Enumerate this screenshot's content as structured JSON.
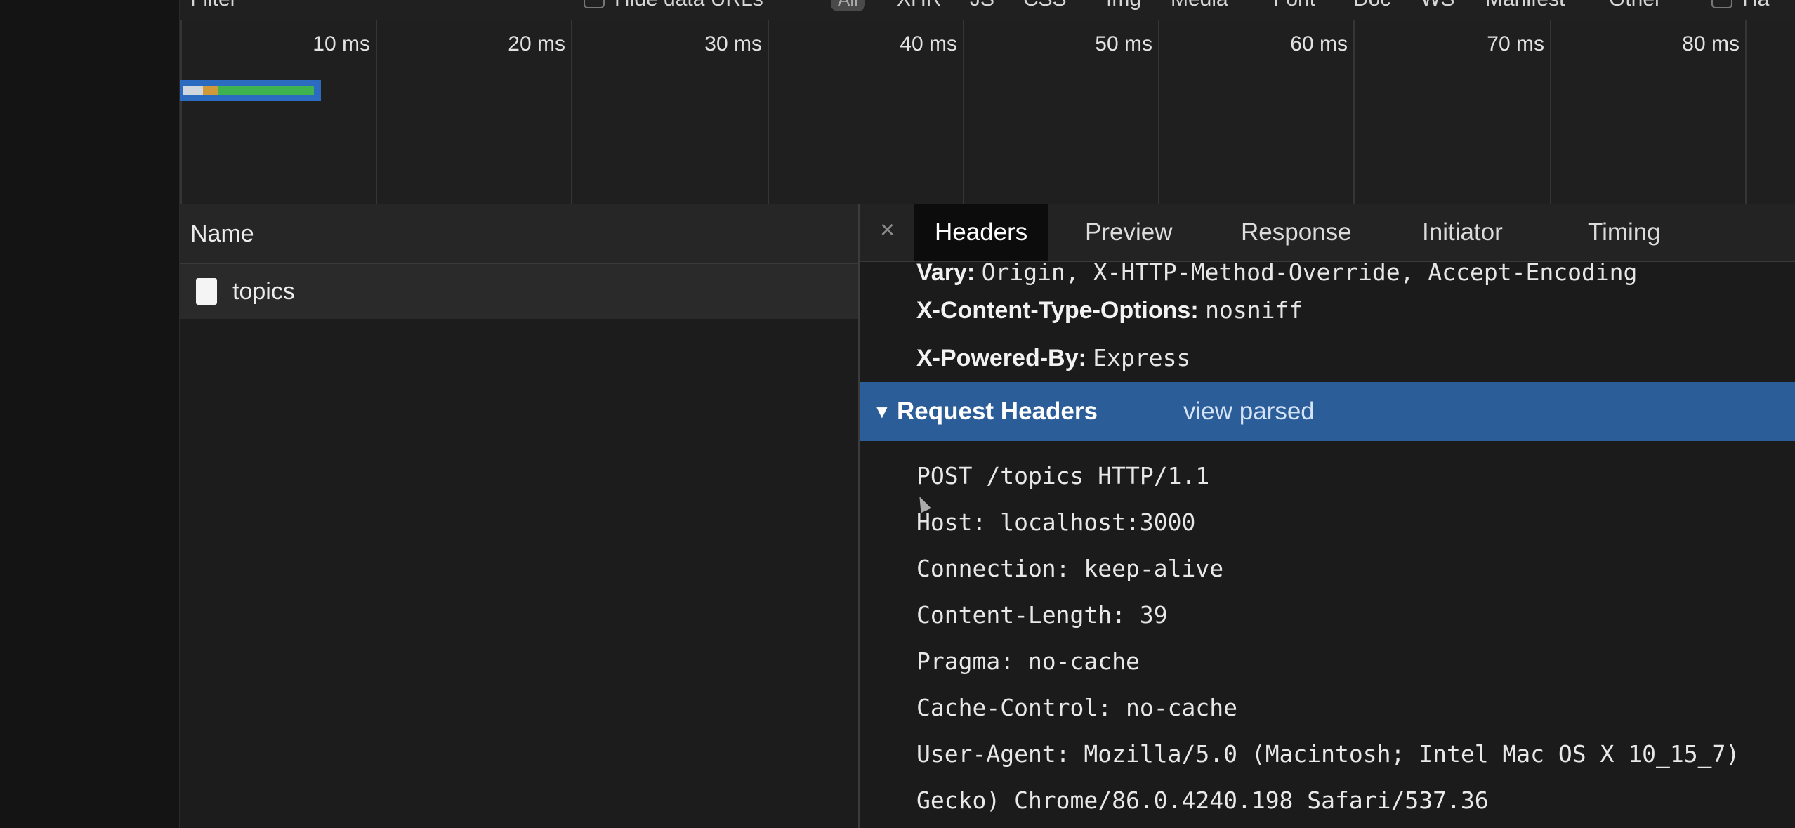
{
  "filter_bar": {
    "filter_label": "Filter",
    "hide_data_urls_label": "Hide data URLs",
    "all_label": "All",
    "types": [
      "XHR",
      "JS",
      "CSS",
      "Img",
      "Media",
      "Font",
      "Doc",
      "WS",
      "Manifest",
      "Other"
    ],
    "has_blocked_label": "Ha"
  },
  "timeline": {
    "ticks": [
      "10 ms",
      "20 ms",
      "30 ms",
      "40 ms",
      "50 ms",
      "60 ms",
      "70 ms",
      "80 ms"
    ]
  },
  "request_list": {
    "header": "Name",
    "rows": [
      {
        "name": "topics"
      }
    ]
  },
  "details": {
    "close_label": "×",
    "tabs": [
      "Headers",
      "Preview",
      "Response",
      "Initiator",
      "Timing"
    ],
    "active_tab": "Headers",
    "response_headers": [
      {
        "key": "Vary:",
        "value": "Origin, X-HTTP-Method-Override, Accept-Encoding"
      },
      {
        "key": "X-Content-Type-Options:",
        "value": "nosniff"
      },
      {
        "key": "X-Powered-By:",
        "value": "Express"
      }
    ],
    "request_section": {
      "toggle": "▼",
      "title": "Request Headers",
      "link": "view parsed"
    },
    "request_raw": [
      "POST /topics HTTP/1.1",
      "Host: localhost:3000",
      "Connection: keep-alive",
      "Content-Length: 39",
      "Pragma: no-cache",
      "Cache-Control: no-cache",
      "User-Agent: Mozilla/5.0 (Macintosh; Intel Mac OS X 10_15_7)",
      "Gecko) Chrome/86.0.4240.198 Safari/537.36"
    ]
  },
  "colors": {
    "section_bar": "#2b5d98",
    "waterfall_blue": "#2b6cc0",
    "waterfall_green": "#3fb34f",
    "waterfall_orange": "#d09a3a"
  }
}
